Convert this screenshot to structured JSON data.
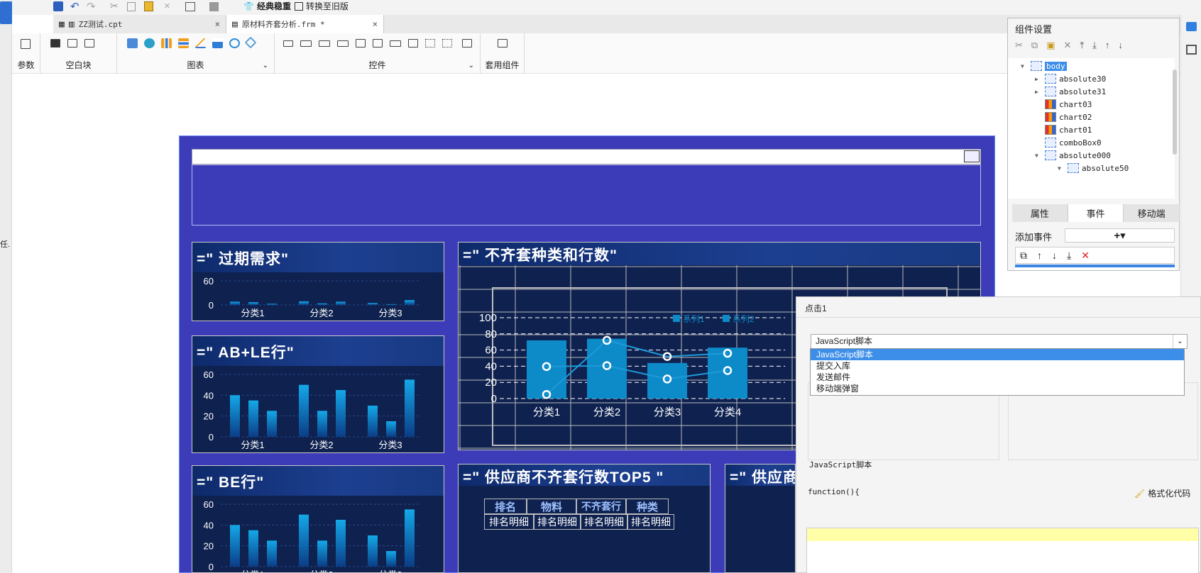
{
  "toolbar_top": {
    "classic_label": "经典稳重",
    "convert_label": "转换至旧版"
  },
  "tabs": [
    {
      "label": "ZZ测试.cpt",
      "close": "×"
    },
    {
      "label": "原材料齐套分析.frm *",
      "close": "×"
    }
  ],
  "toolbar_groups": {
    "params": "参数",
    "blank": "空白块",
    "charts": "图表",
    "controls": "控件",
    "preset": "套用组件"
  },
  "panels": {
    "p1_title": "=\" 过期需求\"",
    "p2_title": "=\" AB+LE行\"",
    "p3_title": "=\" BE行\"",
    "p4_title": "=\"   不齐套种类和行数\"",
    "p5_title": "=\" 供应商不齐套行数TOP5 \"",
    "p6_title": "=\" 供应商"
  },
  "small_chart": {
    "categories": [
      "分类1",
      "分类2",
      "分类3"
    ],
    "yticks": [
      "60",
      "40",
      "20",
      "0"
    ],
    "yticks_short": [
      "60",
      "0"
    ]
  },
  "chart_data": {
    "type": "bar",
    "categories": [
      "分类1",
      "分类2",
      "分类3",
      "分类4"
    ],
    "series": [
      {
        "name": "系列1",
        "values": [
          72,
          74,
          44,
          63
        ]
      },
      {
        "name": "系列2",
        "values": [
          5,
          72,
          52,
          56
        ]
      }
    ],
    "ylim": [
      0,
      100
    ],
    "yticks": [
      "100",
      "80",
      "60",
      "40",
      "20",
      "0"
    ]
  },
  "top5_table": {
    "headers": [
      "排名",
      "物料",
      "不齐套行",
      "种类"
    ],
    "row": [
      "排名明细",
      "排名明细",
      "排名明细",
      "排名明细"
    ]
  },
  "component_settings": {
    "title": "组件设置",
    "tree": [
      {
        "label": "body",
        "type": "body"
      },
      {
        "label": "absolute30",
        "type": "abs"
      },
      {
        "label": "absolute31",
        "type": "abs"
      },
      {
        "label": "chart03",
        "type": "chart"
      },
      {
        "label": "chart02",
        "type": "chart"
      },
      {
        "label": "chart01",
        "type": "chart"
      },
      {
        "label": "comboBox0",
        "type": "combo"
      },
      {
        "label": "absolute000",
        "type": "abs"
      },
      {
        "label": "absolute50",
        "type": "abs"
      }
    ],
    "tabs": [
      "属性",
      "事件",
      "移动端"
    ],
    "add_event": "添加事件",
    "plus": "+▾"
  },
  "dialog": {
    "title": "点击1",
    "select_value": "JavaScript脚本",
    "options": [
      "JavaScript脚本",
      "提交入库",
      "发送邮件",
      "移动端弹窗"
    ],
    "script_section": "JavaScript脚本",
    "code_start": "function(){",
    "format_label": "格式化代码"
  },
  "left_strip": {
    "fragment": "任."
  }
}
